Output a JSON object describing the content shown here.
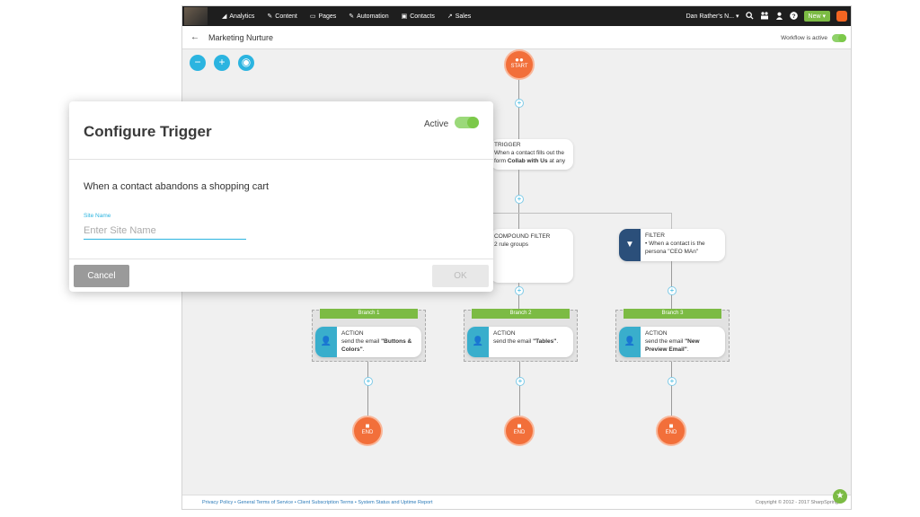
{
  "nav": {
    "items": [
      {
        "icon": "analytics-icon",
        "glyph": "◢",
        "label": "Analytics"
      },
      {
        "icon": "content-icon",
        "glyph": "✎",
        "label": "Content"
      },
      {
        "icon": "pages-icon",
        "glyph": "▭",
        "label": "Pages"
      },
      {
        "icon": "automation-icon",
        "glyph": "✎",
        "label": "Automation"
      },
      {
        "icon": "contacts-icon",
        "glyph": "▣",
        "label": "Contacts"
      },
      {
        "icon": "sales-icon",
        "glyph": "↗",
        "label": "Sales"
      }
    ],
    "account": "Dan Rather's N... ▾",
    "new_label": "New ▾"
  },
  "subbar": {
    "back": "←",
    "title": "Marketing Nurture",
    "workflow_status": "Workflow is active"
  },
  "zoom": {
    "minus": "−",
    "plus": "+",
    "center": "◉"
  },
  "flow": {
    "start_label": "START",
    "end_label": "END",
    "trigger": {
      "title": "TRIGGER",
      "line1": "When a contact fills out the",
      "line2_pre": "form ",
      "line2_bold": "Collab with Us",
      "line2_post": " at any"
    },
    "compound_filter": {
      "title": "COMPOUND FILTER",
      "line1": "2 rule groups"
    },
    "filter": {
      "title": "FILTER",
      "line1": "• When a contact is the",
      "line2": "persona \"CEO MAn\""
    },
    "branches": [
      {
        "label": "Branch 1",
        "action_title": "ACTION",
        "line1_pre": "send the email ",
        "line1_bold": "\"Buttons &",
        "line2_bold": "Colors\"",
        "line2_post": "."
      },
      {
        "label": "Branch 2",
        "action_title": "ACTION",
        "line1_pre": "send the email ",
        "line1_bold": "\"Tables\"",
        "line2_bold": "",
        "line2_post": "."
      },
      {
        "label": "Branch 3",
        "action_title": "ACTION",
        "line1_pre": "send the email ",
        "line1_bold": "\"New",
        "line2_bold": "Preview Email\"",
        "line2_post": "."
      }
    ]
  },
  "footer": {
    "links": "Privacy Policy • General Terms of Service • Client Subscription Terms • System Status and Uptime Report",
    "copyright": "Copyright © 2012 - 2017 SharpSpring"
  },
  "modal": {
    "title": "Configure Trigger",
    "active_label": "Active",
    "description": "When a contact abandons a shopping cart",
    "field_label": "Site Name",
    "field_placeholder": "Enter Site Name",
    "field_value": "",
    "cancel_label": "Cancel",
    "ok_label": "OK"
  },
  "colors": {
    "accent": "#2bb4e0",
    "start_end": "#f26f3a",
    "branch": "#7cbb44",
    "filter_dark": "#2b4f7a"
  }
}
